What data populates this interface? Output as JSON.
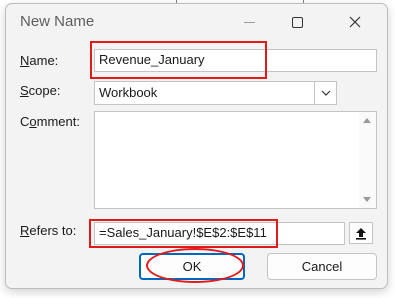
{
  "window": {
    "title": "New Name",
    "minimize_icon": "minimize-icon",
    "maximize_icon": "maximize-icon",
    "close_icon": "close-icon"
  },
  "form": {
    "name_label_accel": "N",
    "name_label_rest": "ame:",
    "name_value": "Revenue_January",
    "scope_label_accel": "S",
    "scope_label_rest": "cope:",
    "scope_value": "Workbook",
    "comment_label_prefix": "C",
    "comment_label_accel": "o",
    "comment_label_rest": "mment:",
    "comment_value": "",
    "refers_label_accel": "R",
    "refers_label_rest": "efers to:",
    "refers_value": "=Sales_January!$E$2:$E$11"
  },
  "buttons": {
    "ok_label": "OK",
    "cancel_label": "Cancel"
  },
  "colors": {
    "highlight": "#e41a1a",
    "accent": "#0067c0",
    "dialog_bg": "#f3f3f3"
  }
}
